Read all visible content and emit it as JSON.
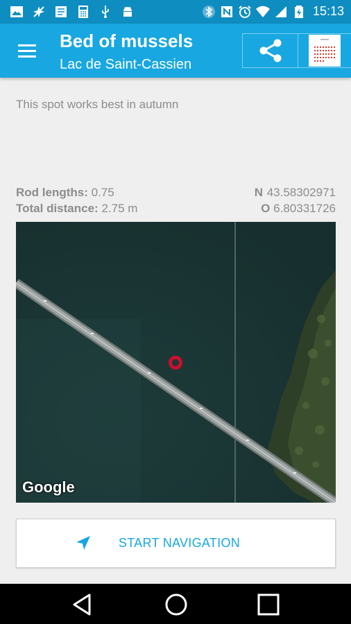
{
  "status_bar": {
    "time": "15:13",
    "left_icons": [
      "image-icon",
      "gps-off-icon",
      "notes-icon",
      "calculator-icon",
      "usb-icon",
      "android-icon"
    ],
    "right_icons": [
      "bluetooth-icon",
      "nfc-icon",
      "alarm-icon",
      "wifi-icon",
      "signal-icon",
      "battery-icon"
    ]
  },
  "header": {
    "title": "Bed of mussels",
    "subtitle": "Lac de Saint-Cassien"
  },
  "spot": {
    "description": "This spot works best in autumn",
    "rod_lengths_label": "Rod lengths:",
    "rod_lengths_value": "0.75",
    "total_distance_label": "Total distance:",
    "total_distance_value": "2.75 m",
    "lat_label": "N",
    "lat_value": "43.58302971",
    "lon_label": "O",
    "lon_value": "6.80331726"
  },
  "map": {
    "attribution": "Google",
    "marker_color": "#c8102e"
  },
  "actions": {
    "start_navigation": "START NAVIGATION"
  },
  "colors": {
    "accent": "#18a7e0",
    "status_bar": "#0e8dc0"
  }
}
